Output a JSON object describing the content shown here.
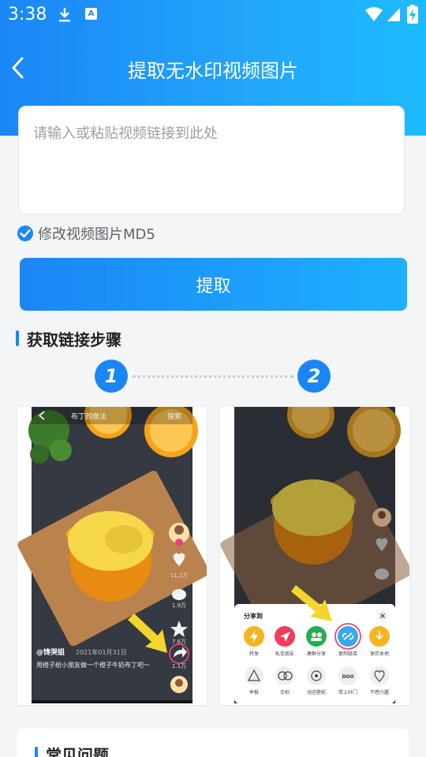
{
  "status_bar": {
    "time": "3:38",
    "icons": [
      "download-icon",
      "a-icon",
      "wifi-icon",
      "signal-icon",
      "battery-charging-icon"
    ],
    "a_icon_text": "A"
  },
  "nav": {
    "title": "提取无水印视频图片",
    "back_icon": "chevron-left-icon"
  },
  "link_input": {
    "placeholder": "请输入或粘贴视频链接到此处",
    "value": ""
  },
  "md5_option": {
    "label": "修改视频图片MD5",
    "checked": true
  },
  "extract_button": {
    "label": "提取"
  },
  "steps_section": {
    "title": "获取链接步骤",
    "step_numbers": [
      "1",
      "2"
    ],
    "step1_screenshot": {
      "top_left": "布丁的做法",
      "top_right": "搜索",
      "author": "@馋哭姐",
      "date": "2021年01月31日",
      "caption": "用橙子给小朋友做一个橙子牛奶布丁吧～",
      "like_count": "11.2万",
      "comment_count": "1.9万",
      "favorite_count": "7.6万",
      "share_count": "1.1万"
    },
    "step2_screenshot": {
      "share_title": "分享到",
      "share_row1": [
        "转发",
        "私信朋友",
        "建群分享",
        "复制链接",
        "保存本地"
      ],
      "share_row2": [
        "举报",
        "合拍",
        "动态壁纸",
        "带上抖门",
        "不感兴趣"
      ]
    }
  },
  "faq_section": {
    "title": "常见问题"
  },
  "colors": {
    "brand_blue": "#1a86f5",
    "gradient_end": "#1fb0ff",
    "page_bg": "#f4f5f7",
    "highlight_pink": "#e8457a",
    "arrow_yellow": "#f2d62e"
  }
}
